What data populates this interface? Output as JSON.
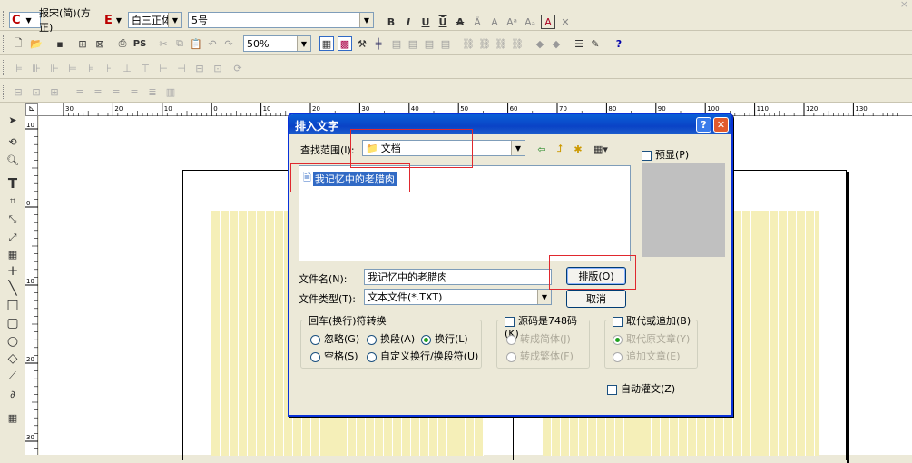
{
  "font_bar": {
    "cn_font_label": "报宋(简)(方正)",
    "en_font_label": "白三正体",
    "size_value": "5号"
  },
  "toolbar": {
    "zoom_value": "50%",
    "ps_label": "PS"
  },
  "ruler": {
    "ticks": [
      "30",
      "20",
      "10",
      "0",
      "10",
      "20",
      "30",
      "40",
      "50",
      "60",
      "70",
      "80",
      "90",
      "100",
      "110",
      "120",
      "130"
    ]
  },
  "vruler": {
    "ticks": [
      "10",
      "0",
      "10",
      "20",
      "30"
    ]
  },
  "dialog": {
    "title": "排入文字",
    "lookin_label": "查找范围(I):",
    "lookin_value": "文档",
    "files": [
      "我记忆中的老腊肉"
    ],
    "preview_label": "预显(P)",
    "filename_label": "文件名(N):",
    "filename_value": "我记忆中的老腊肉",
    "filetype_label": "文件类型(T):",
    "filetype_value": "文本文件(*.TXT)",
    "ok_label": "排版(O)",
    "cancel_label": "取消",
    "group_return": {
      "title": "回车(换行)符转换",
      "options": [
        "忽略(G)",
        "换段(A)",
        "换行(L)",
        "空格(S)",
        "自定义换行/换段符(U)"
      ]
    },
    "group_code": {
      "title": "源码是748码(K)",
      "options": [
        "转成简体(J)",
        "转成繁体(F)"
      ]
    },
    "group_replace": {
      "title": "取代或追加(B)",
      "options": [
        "取代原文章(Y)",
        "追加文章(E)"
      ]
    },
    "auto_label": "自动灌文(Z)"
  },
  "colors": {
    "title_bar": "#0a43c6",
    "highlight": "#316ac5",
    "marker": "#e0282e"
  }
}
